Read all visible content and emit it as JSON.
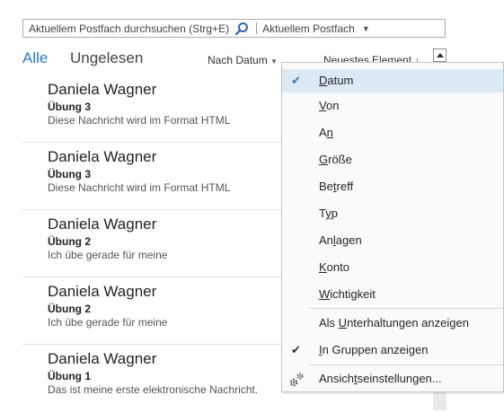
{
  "search": {
    "placeholder": "Aktuellem Postfach durchsuchen (Strg+E)",
    "scope": "Aktuellem Postfach"
  },
  "filter": {
    "all": "Alle",
    "unread": "Ungelesen",
    "sort": "Nach Datum",
    "newest": "Neuestes Element",
    "accent_color": "#2b79d0"
  },
  "messages": [
    {
      "sender": "Daniela Wagner",
      "subject": "Übung 3",
      "preview": "Diese Nachricht wird im Format HTML"
    },
    {
      "sender": "Daniela Wagner",
      "subject": "Übung 3",
      "preview": "Diese Nachricht wird im Format HTML"
    },
    {
      "sender": "Daniela Wagner",
      "subject": "Übung 2",
      "preview": "Ich übe gerade für meine"
    },
    {
      "sender": "Daniela Wagner",
      "subject": "Übung 2",
      "preview": "Ich übe gerade für meine"
    },
    {
      "sender": "Daniela Wagner",
      "subject": "Übung 1",
      "preview": "Das ist meine erste elektronische Nachricht."
    }
  ],
  "menu": {
    "items": [
      {
        "pre": "",
        "key": "D",
        "post": "atum",
        "checked": true
      },
      {
        "pre": "",
        "key": "V",
        "post": "on"
      },
      {
        "pre": "A",
        "key": "n",
        "post": ""
      },
      {
        "pre": "",
        "key": "G",
        "post": "röße"
      },
      {
        "pre": "Be",
        "key": "t",
        "post": "reff"
      },
      {
        "pre": "T",
        "key": "y",
        "post": "p"
      },
      {
        "pre": "An",
        "key": "l",
        "post": "agen"
      },
      {
        "pre": "",
        "key": "K",
        "post": "onto"
      },
      {
        "pre": "",
        "key": "W",
        "post": "ichtigkeit"
      }
    ],
    "conversations": {
      "pre": "Als ",
      "key": "U",
      "post": "nterhaltungen anzeigen"
    },
    "groups": {
      "pre": "",
      "key": "I",
      "post": "n Gruppen anzeigen",
      "checked": true
    },
    "settings": {
      "pre": "Ansich",
      "key": "t",
      "post": "seinstellungen..."
    }
  }
}
